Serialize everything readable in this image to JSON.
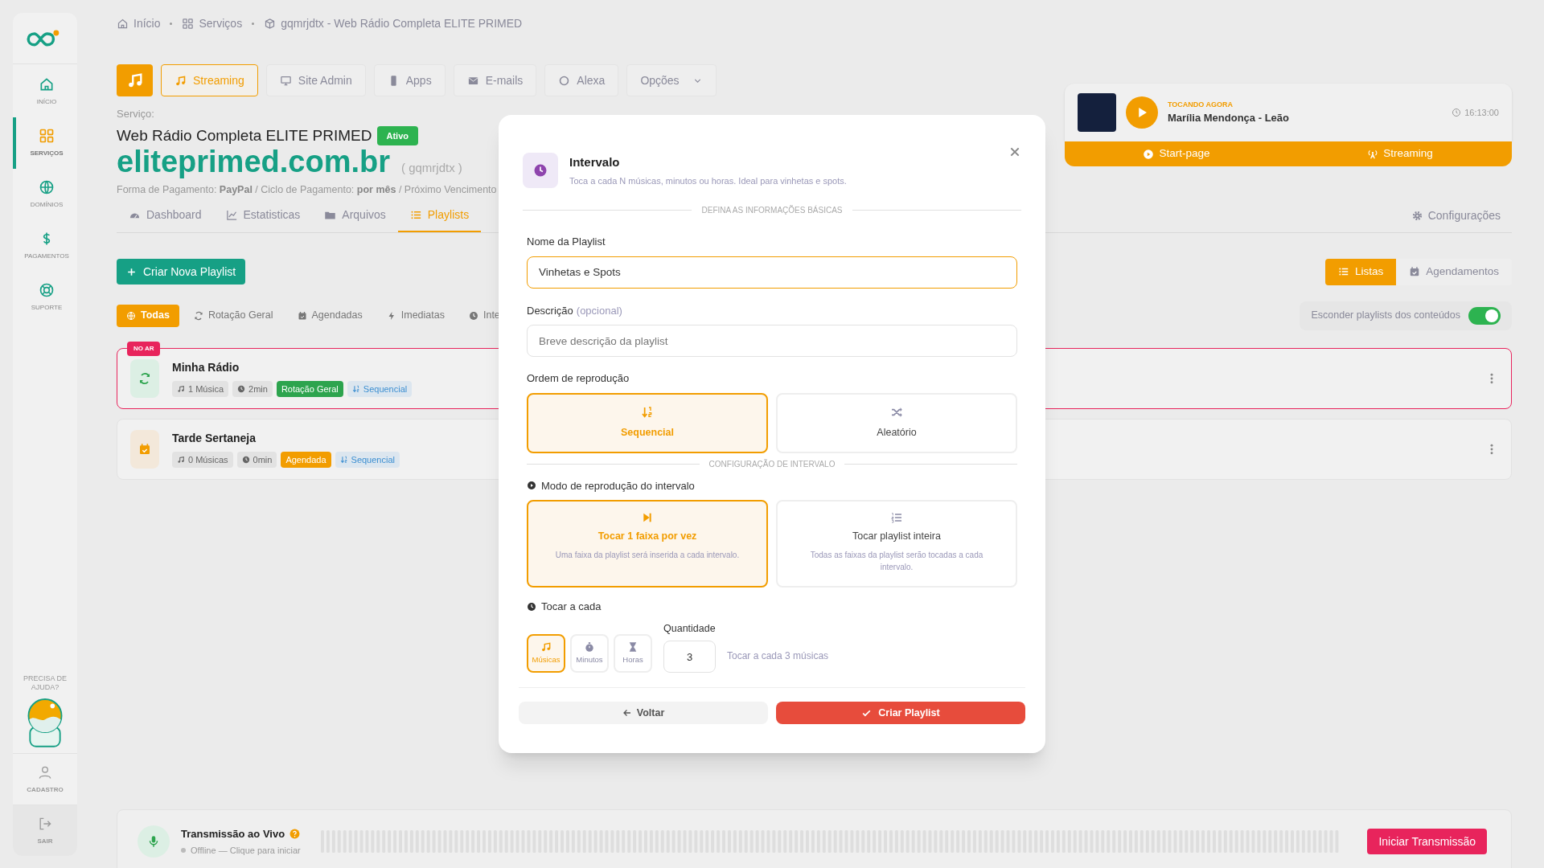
{
  "sidebar": {
    "items": [
      {
        "label": "INÍCIO",
        "kind": "home",
        "selected": false
      },
      {
        "label": "SERVIÇOS",
        "kind": "grid",
        "selected": true
      },
      {
        "label": "DOMÍNIOS",
        "kind": "globe",
        "selected": false
      },
      {
        "label": "PAGAMENTOS",
        "kind": "dollar",
        "selected": false
      },
      {
        "label": "SUPORTE",
        "kind": "lifebuoy",
        "selected": false
      }
    ],
    "help": "PRECISA DE AJUDA?",
    "bottom_items": [
      {
        "label": "CADASTRO",
        "kind": "user"
      },
      {
        "label": "SAIR",
        "kind": "logout"
      }
    ]
  },
  "breadcrumb": [
    {
      "label": "Início",
      "kind": "home"
    },
    {
      "label": "Serviços",
      "kind": "grid"
    },
    {
      "label": "gqmrjdtx - Web Rádio Completa ELITE PRIMED",
      "kind": "cube"
    }
  ],
  "service_tabs": [
    {
      "label": "Streaming",
      "kind": "music",
      "selected": true
    },
    {
      "label": "Site Admin",
      "kind": "monitor",
      "selected": false
    },
    {
      "label": "Apps",
      "kind": "phone",
      "selected": false
    },
    {
      "label": "E-mails",
      "kind": "mail",
      "selected": false
    },
    {
      "label": "Alexa",
      "kind": "ring",
      "selected": false
    },
    {
      "label": "Opções",
      "kind": "dropdown",
      "selected": false
    }
  ],
  "service": {
    "label": "Serviço:",
    "name": "Web Rádio Completa ELITE PRIMED",
    "status": "Ativo",
    "domain": "eliteprimed.com.br",
    "code": "( gqmrjdtx )",
    "payment": "Forma de Pagamento: **PayPal** / Ciclo de Pagamento: **por mês** / Próximo Vencimento"
  },
  "now_playing": {
    "label": "TOCANDO AGORA",
    "track": "Marília Mendonça - Leão",
    "time": "16:13:00",
    "links": [
      {
        "label": "Start-page",
        "kind": "play"
      },
      {
        "label": "Streaming",
        "kind": "antenna"
      }
    ]
  },
  "tabs": [
    {
      "label": "Dashboard",
      "kind": "gauge",
      "selected": false
    },
    {
      "label": "Estatisticas",
      "kind": "chart",
      "selected": false
    },
    {
      "label": "Arquivos",
      "kind": "folder",
      "selected": false
    },
    {
      "label": "Playlists",
      "kind": "list",
      "selected": true
    }
  ],
  "settings_link": "Configurações",
  "create_button": "Criar Nova Playlist",
  "view_toggle": [
    {
      "label": "Listas",
      "kind": "list",
      "selected": true
    },
    {
      "label": "Agendamentos",
      "kind": "calendar",
      "selected": false
    }
  ],
  "filters": [
    {
      "label": "Todas",
      "kind": "globe",
      "selected": true
    },
    {
      "label": "Rotação Geral",
      "kind": "sync",
      "selected": false
    },
    {
      "label": "Agendadas",
      "kind": "calendar",
      "selected": false
    },
    {
      "label": "Imediatas",
      "kind": "bolt",
      "selected": false
    },
    {
      "label": "Inte",
      "kind": "clock",
      "selected": false
    }
  ],
  "hide_toggle": {
    "label": "Esconder playlists dos conteúdos",
    "on": true
  },
  "playlists": [
    {
      "name": "Minha Rádio",
      "kind": "rotation",
      "on_air": "NO AR",
      "songs": "1 Música",
      "duration": "2min",
      "type": "Rotação Geral",
      "order": "Sequencial"
    },
    {
      "name": "Tarde Sertaneja",
      "kind": "scheduled",
      "songs": "0 Músicas",
      "duration": "0min",
      "type": "Agendada",
      "order": "Sequencial"
    }
  ],
  "modal": {
    "title": "Intervalo",
    "subtitle": "Toca a cada N músicas, minutos ou horas. Ideal para vinhetas e spots.",
    "section_basic": "DEFINA AS INFORMAÇÕES BÁSICAS",
    "name_label": "Nome da Playlist",
    "name_value": "Vinhetas e Spots",
    "description_label": "Descrição",
    "description_hint": "(opcional)",
    "description_placeholder": "Breve descrição da playlist",
    "order_label": "Ordem de reprodução",
    "order_options": [
      {
        "label": "Sequencial",
        "kind": "sequential",
        "selected": true
      },
      {
        "label": "Aleatório",
        "kind": "shuffle",
        "selected": false
      }
    ],
    "section_interval": "CONFIGURAÇÃO DE INTERVALO",
    "mode_label": "Modo de reprodução do intervalo",
    "modes": [
      {
        "title": "Tocar 1 faixa por vez",
        "description": "Uma faixa da playlist será inserida a cada intervalo.",
        "kind": "single",
        "selected": true
      },
      {
        "title": "Tocar playlist inteira",
        "description": "Todas as faixas da playlist serão tocadas a cada intervalo.",
        "kind": "whole",
        "selected": false
      }
    ],
    "every_label": "Tocar a cada",
    "units": [
      {
        "label": "Músicas",
        "kind": "music",
        "selected": true
      },
      {
        "label": "Minutos",
        "kind": "stopwatch",
        "selected": false
      },
      {
        "label": "Horas",
        "kind": "hourglass",
        "selected": false
      }
    ],
    "quantity_label": "Quantidade",
    "quantity": "3",
    "quantity_hint": "Tocar a cada 3 músicas",
    "back_button": "Voltar",
    "submit_button": "Criar Playlist"
  },
  "live": {
    "title": "Transmissão ao Vivo",
    "status": "Offline — Clique para iniciar",
    "button": "Iniciar Transmissão"
  }
}
